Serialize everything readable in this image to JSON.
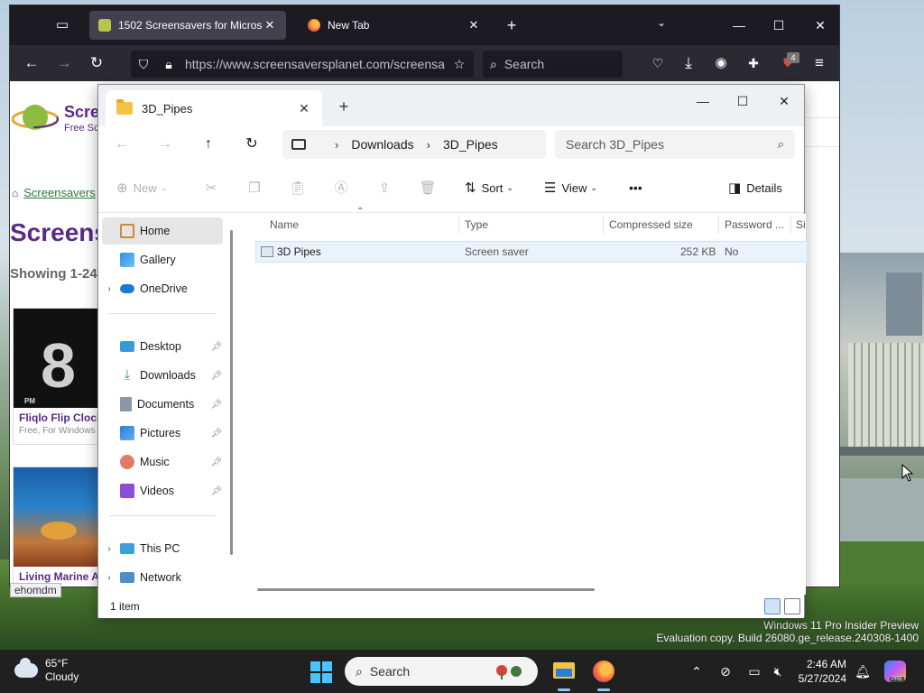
{
  "browser": {
    "tabs": [
      {
        "label": "1502 Screensavers for Microsoft",
        "active": true
      },
      {
        "label": "New Tab",
        "active": false
      }
    ],
    "url": "https://www.screensaversplanet.com/screensav",
    "search_placeholder": "Search",
    "extension_badge": "4"
  },
  "webpage": {
    "site_name": "Scre",
    "site_tagline": "Free Sc",
    "breadcrumb": "Screensavers",
    "heading": "Screens",
    "showing": "Showing 1-24",
    "cards": [
      {
        "name": "Fliqlo Flip Clock",
        "sub": "Free, For Windows",
        "thumb_digit": "8",
        "thumb_pm": "PM"
      },
      {
        "name": "Living Marine Aq",
        "sub": ""
      }
    ],
    "status_link": "ehomdm"
  },
  "explorer": {
    "tab_title": "3D_Pipes",
    "path": [
      "Downloads",
      "3D_Pipes"
    ],
    "search_placeholder": "Search 3D_Pipes",
    "commands": {
      "new": "New",
      "sort": "Sort",
      "view": "View",
      "more": "•••",
      "details": "Details"
    },
    "nav": {
      "home": "Home",
      "gallery": "Gallery",
      "onedrive": "OneDrive",
      "desktop": "Desktop",
      "downloads": "Downloads",
      "documents": "Documents",
      "pictures": "Pictures",
      "music": "Music",
      "videos": "Videos",
      "this_pc": "This PC",
      "network": "Network"
    },
    "columns": {
      "name": "Name",
      "type": "Type",
      "compressed_size": "Compressed size",
      "password": "Password ...",
      "size": "Si"
    },
    "files": [
      {
        "name": "3D Pipes",
        "type": "Screen saver",
        "compressed_size": "252 KB",
        "password": "No"
      }
    ],
    "status": "1 item"
  },
  "desktop": {
    "watermark_line1": "Windows 11 Pro Insider Preview",
    "watermark_line2": "Evaluation copy. Build 26080.ge_release.240308-1400"
  },
  "taskbar": {
    "temperature": "65°F",
    "condition": "Cloudy",
    "search_label": "Search",
    "time": "2:46 AM",
    "date": "5/27/2024",
    "copilot_badge": "PRE"
  }
}
